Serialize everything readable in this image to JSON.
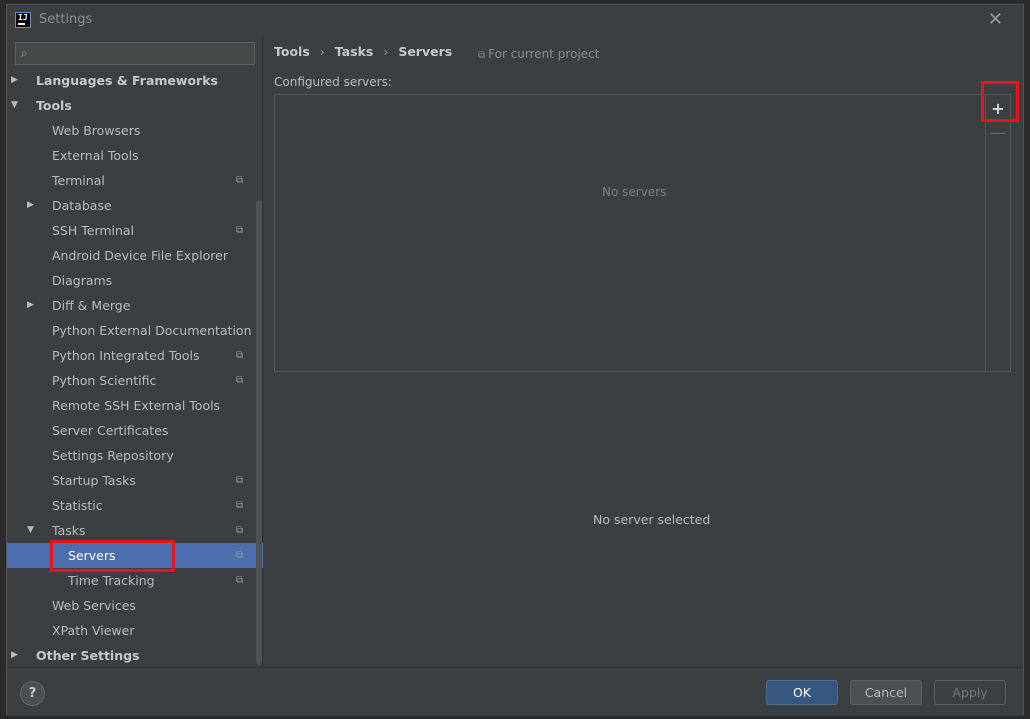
{
  "window": {
    "title": "Settings",
    "logo_text": "IJ"
  },
  "search": {
    "placeholder": ""
  },
  "tree": [
    {
      "label": "Languages & Frameworks",
      "level": 0,
      "expanded": false,
      "bold": true
    },
    {
      "label": "Tools",
      "level": 0,
      "expanded": true,
      "bold": true
    },
    {
      "label": "Web Browsers",
      "level": 1
    },
    {
      "label": "External Tools",
      "level": 1
    },
    {
      "label": "Terminal",
      "level": 1,
      "project": true
    },
    {
      "label": "Database",
      "level": 1,
      "expanded": false
    },
    {
      "label": "SSH Terminal",
      "level": 1,
      "project": true
    },
    {
      "label": "Android Device File Explorer",
      "level": 1
    },
    {
      "label": "Diagrams",
      "level": 1
    },
    {
      "label": "Diff & Merge",
      "level": 1,
      "expanded": false
    },
    {
      "label": "Python External Documentation",
      "level": 1
    },
    {
      "label": "Python Integrated Tools",
      "level": 1,
      "project": true
    },
    {
      "label": "Python Scientific",
      "level": 1,
      "project": true
    },
    {
      "label": "Remote SSH External Tools",
      "level": 1
    },
    {
      "label": "Server Certificates",
      "level": 1
    },
    {
      "label": "Settings Repository",
      "level": 1
    },
    {
      "label": "Startup Tasks",
      "level": 1,
      "project": true
    },
    {
      "label": "Statistic",
      "level": 1,
      "project": true
    },
    {
      "label": "Tasks",
      "level": 1,
      "expanded": true,
      "project": true
    },
    {
      "label": "Servers",
      "level": 2,
      "project": true,
      "selected": true
    },
    {
      "label": "Time Tracking",
      "level": 2,
      "project": true
    },
    {
      "label": "Web Services",
      "level": 1
    },
    {
      "label": "XPath Viewer",
      "level": 1
    },
    {
      "label": "Other Settings",
      "level": 0,
      "expanded": false,
      "bold": true
    }
  ],
  "breadcrumb": [
    "Tools",
    "Tasks",
    "Servers"
  ],
  "breadcrumb_sep": "›",
  "scope_note": "For current project",
  "configured_label": "Configured servers:",
  "servers_empty": "No servers",
  "add_label": "+",
  "remove_label": "—",
  "no_selection": "No server selected",
  "buttons": {
    "help": "?",
    "ok": "OK",
    "cancel": "Cancel",
    "apply": "Apply"
  },
  "colors": {
    "accent": "#4b6eaf",
    "ok_button": "#365880",
    "highlight": "#e8141c"
  }
}
